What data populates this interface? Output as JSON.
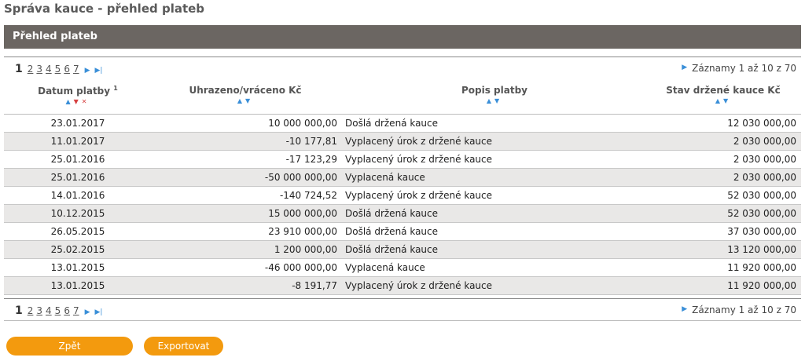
{
  "page_title": "Správa kauce - přehled plateb",
  "section_title": "Přehled plateb",
  "pager": {
    "current": "1",
    "pages": [
      "2",
      "3",
      "4",
      "5",
      "6",
      "7"
    ],
    "records_text": "Záznamy 1 až 10 z 70"
  },
  "columns": {
    "date": "Datum platby",
    "date_sup": "1",
    "amount": "Uhrazeno/vráceno Kč",
    "description": "Popis platby",
    "balance": "Stav držené kauce Kč"
  },
  "rows": [
    {
      "date": "23.01.2017",
      "amount": "10 000 000,00",
      "description": "Došlá držená kauce",
      "balance": "12 030 000,00"
    },
    {
      "date": "11.01.2017",
      "amount": "-10 177,81",
      "description": "Vyplacený úrok z držené kauce",
      "balance": "2 030 000,00"
    },
    {
      "date": "25.01.2016",
      "amount": "-17 123,29",
      "description": "Vyplacený úrok z držené kauce",
      "balance": "2 030 000,00"
    },
    {
      "date": "25.01.2016",
      "amount": "-50 000 000,00",
      "description": "Vyplacená kauce",
      "balance": "2 030 000,00"
    },
    {
      "date": "14.01.2016",
      "amount": "-140 724,52",
      "description": "Vyplacený úrok z držené kauce",
      "balance": "52 030 000,00"
    },
    {
      "date": "10.12.2015",
      "amount": "15 000 000,00",
      "description": "Došlá držená kauce",
      "balance": "52 030 000,00"
    },
    {
      "date": "26.05.2015",
      "amount": "23 910 000,00",
      "description": "Došlá držená kauce",
      "balance": "37 030 000,00"
    },
    {
      "date": "25.02.2015",
      "amount": "1 200 000,00",
      "description": "Došlá držená kauce",
      "balance": "13 120 000,00"
    },
    {
      "date": "13.01.2015",
      "amount": "-46 000 000,00",
      "description": "Vyplacená kauce",
      "balance": "11 920 000,00"
    },
    {
      "date": "13.01.2015",
      "amount": "-8 191,77",
      "description": "Vyplacený úrok z držené kauce",
      "balance": "11 920 000,00"
    }
  ],
  "buttons": {
    "back": "Zpět",
    "export": "Exportovat"
  },
  "colors": {
    "header_bg": "#6b6662",
    "button_bg": "#f39a0e",
    "row_alt_bg": "#e9e8e7",
    "sort_blue": "#3a8fd8",
    "sort_red": "#d64040"
  },
  "icons": {
    "next": "next-page-icon",
    "last": "last-page-icon",
    "sort_asc": "sort-ascending-icon",
    "sort_desc": "sort-descending-icon",
    "remove_sort": "remove-sort-icon"
  }
}
